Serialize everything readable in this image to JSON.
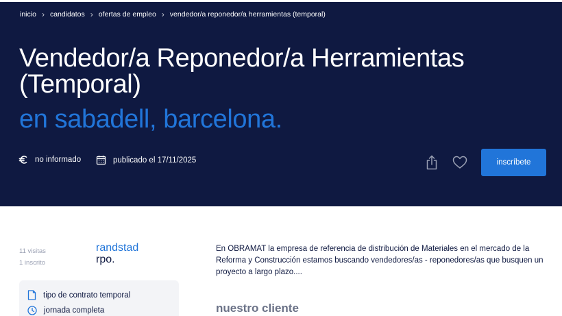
{
  "breadcrumb": {
    "items": [
      "inicio",
      "candidatos",
      "ofertas de empleo",
      "vendedor/a reponedor/a herramientas (temporal)"
    ],
    "separator": "›"
  },
  "job": {
    "title": "Vendedor/a Reponedor/a Herramientas (Temporal)",
    "location": "en sabadell, barcelona.",
    "salary": "no informado",
    "published": "publicado el 17/11/2025"
  },
  "actions": {
    "apply_label": "inscríbete",
    "share_icon": "share-icon",
    "favorite_icon": "heart-icon"
  },
  "stats": {
    "visits": "11 visitas",
    "enrolled": "1 inscrito"
  },
  "company": {
    "line1": "randstad",
    "line2": "rpo."
  },
  "features": [
    {
      "icon": "document-icon",
      "label": "tipo de contrato temporal"
    },
    {
      "icon": "clock-icon",
      "label": "jornada completa"
    }
  ],
  "description": "En OBRAMAT la empresa de referencia de distribución de Materiales en el mercado de la Reforma y Construcción estamos buscando vendedores/as - reponedores/as que busquen un proyecto a largo plazo....",
  "section_title": "nuestro cliente",
  "colors": {
    "hero_bg": "#0f1941",
    "accent": "#2175d9",
    "text_dark": "#0f1941",
    "muted": "#9aa0b3"
  }
}
